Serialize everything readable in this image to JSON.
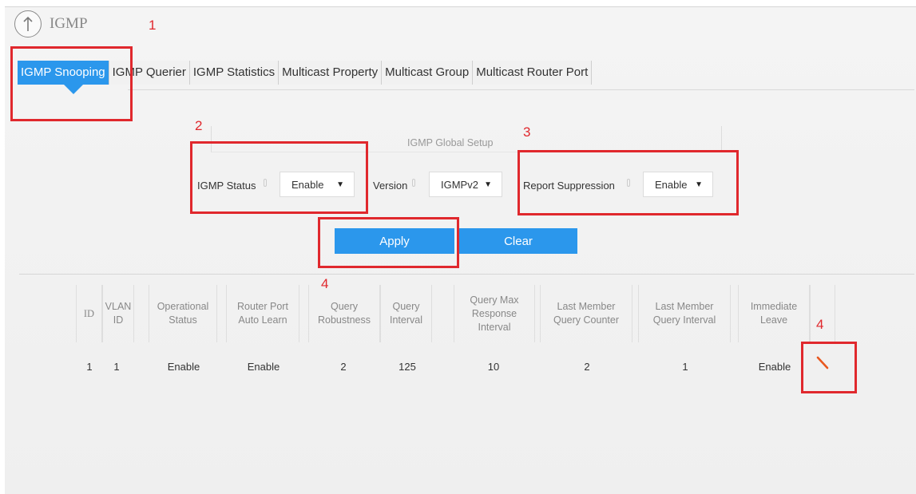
{
  "header": {
    "title": "IGMP",
    "up_icon": "up-arrow-icon"
  },
  "annotations": [
    "1",
    "2",
    "3",
    "4",
    "4"
  ],
  "tabs": [
    {
      "label": "IGMP Snooping",
      "active": true
    },
    {
      "label": "IGMP Querier",
      "active": false
    },
    {
      "label": "IGMP Statistics",
      "active": false
    },
    {
      "label": "Multicast Property",
      "active": false
    },
    {
      "label": "Multicast Group",
      "active": false
    },
    {
      "label": "Multicast Router Port",
      "active": false
    }
  ],
  "setup": {
    "title": "IGMP Global Setup",
    "igmp_status": {
      "label": "IGMP Status",
      "value": "Enable"
    },
    "version": {
      "label": "Version",
      "value": "IGMPv2"
    },
    "report_suppression": {
      "label": "Report Suppression",
      "value": "Enable"
    }
  },
  "buttons": {
    "apply": "Apply",
    "clear": "Clear"
  },
  "table": {
    "headers": [
      "ID",
      "VLAN ID",
      "Operational Status",
      "Router Port Auto Learn",
      "Query Robustness",
      "Query Interval",
      "Query Max Response Interval",
      "Last Member Query Counter",
      "Last Member Query Interval",
      "Immediate Leave",
      ""
    ],
    "rows": [
      [
        "1",
        "1",
        "Enable",
        "Enable",
        "2",
        "125",
        "10",
        "2",
        "1",
        "Enable"
      ]
    ]
  },
  "colors": {
    "accent": "#2b97ec",
    "annotation": "#e0282d",
    "edit_icon": "#e8581f"
  }
}
